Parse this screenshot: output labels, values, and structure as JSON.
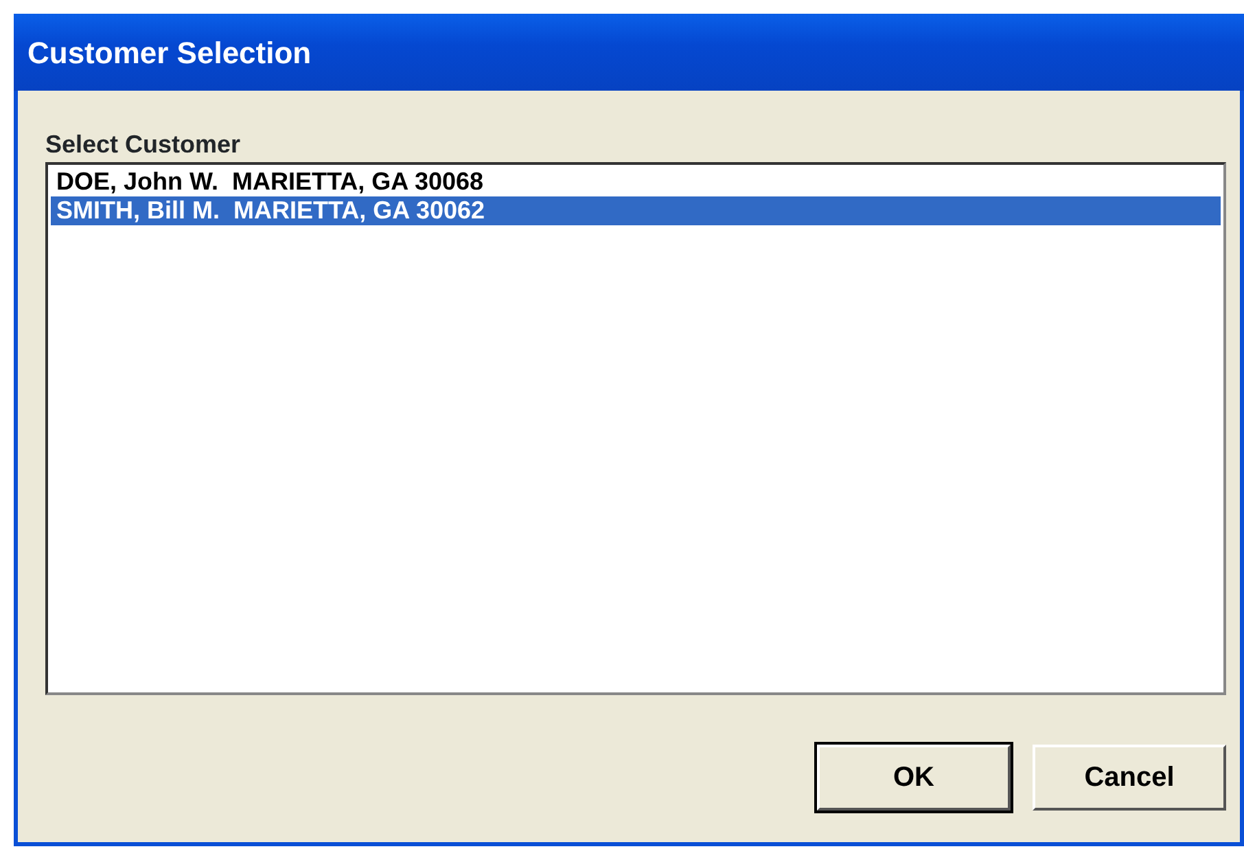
{
  "window": {
    "title": "Customer Selection"
  },
  "label": "Select Customer",
  "customers": [
    {
      "text": "DOE, John W.  MARIETTA, GA 30068",
      "selected": false
    },
    {
      "text": "SMITH, Bill M.  MARIETTA, GA 30062",
      "selected": true
    }
  ],
  "buttons": [
    {
      "label": "OK",
      "default": true
    },
    {
      "label": "Cancel",
      "default": false
    }
  ]
}
